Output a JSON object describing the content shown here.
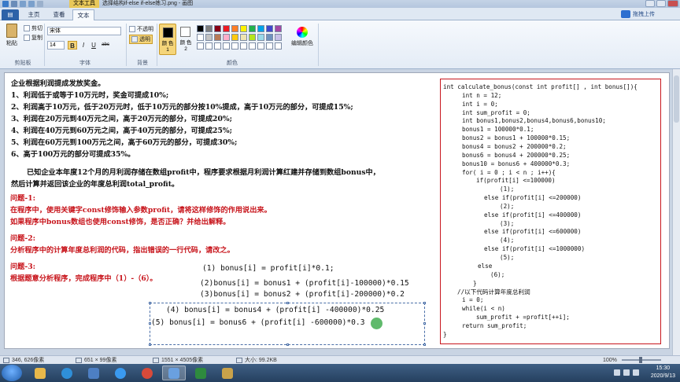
{
  "titlebar": {
    "context_tab": "文本工具",
    "window_title": "选择结构if-else if-else练习.png - 画图"
  },
  "tabs": {
    "file": "",
    "home": "主页",
    "view": "查看",
    "text": "文本",
    "sign_in": "拖拽上传"
  },
  "ribbon": {
    "clipboard": {
      "paste": "粘贴",
      "cut": "剪切",
      "copy": "复制",
      "label": "剪贴板"
    },
    "font": {
      "family": "宋体",
      "size": "14",
      "bold": "B",
      "italic": "I",
      "underline": "U",
      "strike": "abc",
      "label": "字体"
    },
    "background": {
      "opaque": "不透明",
      "transparent": "透明",
      "label": "背景"
    },
    "colors": {
      "color1": "颜\n色 1",
      "color2": "颜\n色 2",
      "edit": "编辑颜色",
      "label": "颜色",
      "palette_row1": [
        "#000000",
        "#7f7f7f",
        "#880015",
        "#ed1c24",
        "#ff7f27",
        "#fff200",
        "#22b14c",
        "#00a2e8",
        "#3f48cc",
        "#a349a4"
      ],
      "palette_row2": [
        "#ffffff",
        "#c3c3c3",
        "#b97a57",
        "#ffaec9",
        "#ffc90e",
        "#efe4b0",
        "#b5e61d",
        "#99d9ea",
        "#7092be",
        "#c8bfe7"
      ]
    }
  },
  "document": {
    "intro": [
      "企业根据利润提成发放奖金。",
      "1、利润低于或等于10万元时，奖金可提成10%;",
      "2、利润高于10万元，低于20万元时，低于10万元的部分按10%提成，高于10万元的部分，可提成15%;",
      "3、利润在20万元到40万元之间，高于20万元的部分，可提成20%;",
      "4、利润在40万元到60万元之间，高于40万元的部分，可提成25%;",
      "5、利润在60万元到100万元之间，高于60万元的部分，可提成30%;",
      "6、高于100万元的部分可提成35%。"
    ],
    "scenario": [
      "已知企业本年度12个月的月利润存储在数组profit中，程序要求根据月利润计算红建并存储到数组bonus中，",
      "然后计算并返回该企业的年度总利润total_profit。"
    ],
    "q1": [
      "问题-1:",
      "在程序中，使用关键字const修饰输入参数profit，请将这样修饰的作用说出来。",
      " 如果程序中bonus数组也使用const修饰，是否正确？并给出解释。"
    ],
    "q2": [
      "问题-2:",
      "分析程序中的计算年度总利润的代码，指出错误的一行代码，请改之。"
    ],
    "q3": [
      "问题-3:",
      "根据题意分析程序，完成程序中（1）-（6）。"
    ],
    "answers": [
      "(1)  bonus[i] = profit[i]*0.1;",
      "(2)bonus[i] = bonus1 + (profit[i]-100000)*0.15",
      "(3)bonus[i] = bonus2 + (profit[i]-200000)*0.2",
      "(4) bonus[i] = bonus4 + (profit[i] -400000)*0.25",
      "(5) bonus[i] = bonus6 + (profit[i] -600000)*0.3"
    ],
    "code": [
      "int calculate_bonus(const int profit[] , int bonus[]){",
      "int n = 12;",
      "int i = 0;",
      "int sum_profit = 0;",
      "int bonus1,bonus2,bonus4,bonus6,bonus10;",
      "bonus1 = 100000*0.1;",
      "bonus2 = bonus1 + 100000*0.15;",
      "bonus4 = bonus2 + 200000*0.2;",
      "bonus6 = bonus4 + 200000*0.25;",
      "bonus10 = bonus6 + 400000*0.3;",
      "for( i = 0 ; i < n ; i++){",
      "if(profit[i] <=100000)",
      "(1);",
      "else if(profit[i] <=200000)",
      "(2);",
      "else if(profit[i] <=400000)",
      "(3);",
      "else if(profit[i] <=600000)",
      "(4);",
      "else if(profit[i] <=1000000)",
      "(5);",
      "else",
      "(6);",
      "}",
      "//以下代码计算年度总利润",
      "i = 0;",
      "while(i < n)",
      "sum_profit + =profit[++i];",
      "return sum_profit;",
      "}"
    ]
  },
  "statusbar": {
    "cursor_pos": "346, 626像素",
    "selection_size": "651 × 99像素",
    "image_size": "1551 × 4505像素",
    "file_size": "大小: 99.2KB",
    "zoom": "100%"
  },
  "taskbar": {
    "time": "15:30",
    "date": "2020/9/13"
  }
}
